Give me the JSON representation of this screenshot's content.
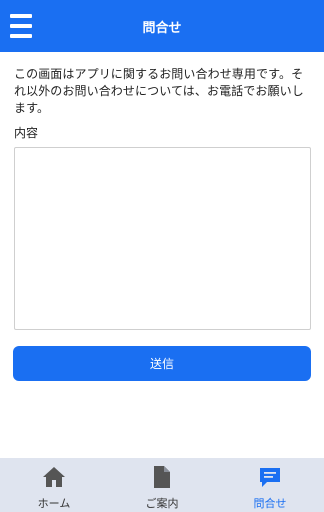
{
  "header": {
    "title": "問合せ",
    "menu_icon": "hamburger-menu-icon",
    "background_color": "#1a6ff2"
  },
  "main": {
    "description": "この画面はアプリに関するお問い合わせ専用です。それ以外のお問い合わせについては、お電話でお願いします。",
    "field_label": "内容",
    "textarea_value": "",
    "send_label": "送信"
  },
  "tabbar": {
    "tabs": [
      {
        "label": "ホーム",
        "icon": "home-icon",
        "active": false
      },
      {
        "label": "ご案内",
        "icon": "document-icon",
        "active": false
      },
      {
        "label": "問合せ",
        "icon": "chat-bubble-icon",
        "active": true
      }
    ],
    "active_color": "#1a6ff2",
    "inactive_icon_color": "#555555"
  }
}
